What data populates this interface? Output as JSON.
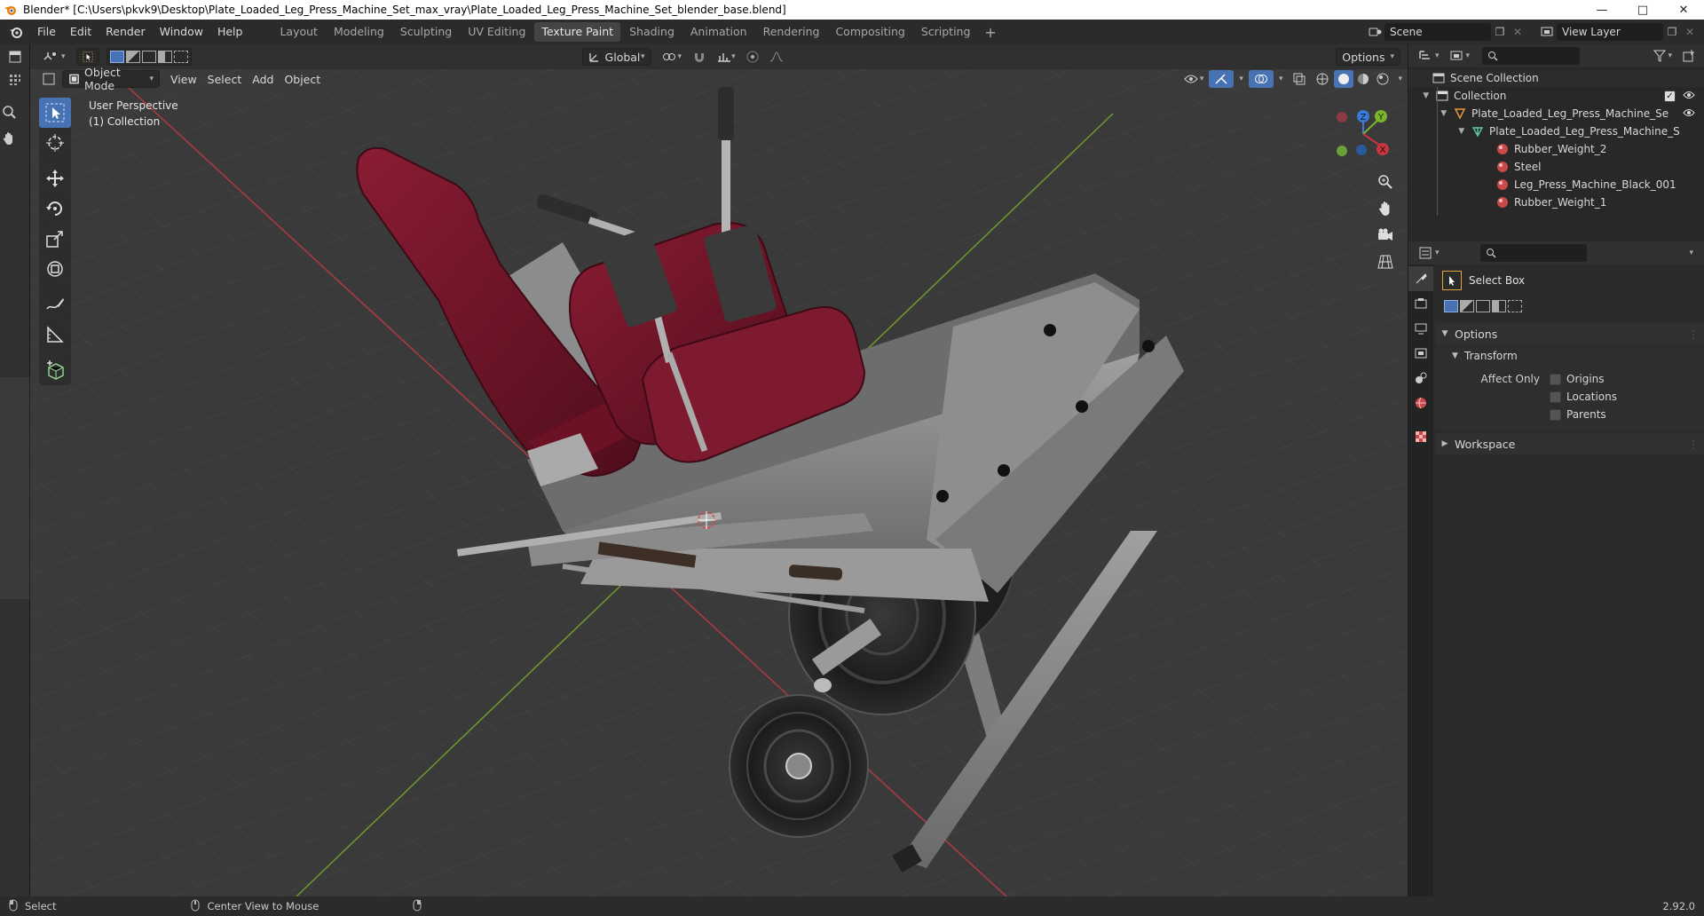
{
  "window": {
    "title": "Blender* [C:\\Users\\pkvk9\\Desktop\\Plate_Loaded_Leg_Press_Machine_Set_max_vray\\Plate_Loaded_Leg_Press_Machine_Set_blender_base.blend]",
    "controls": [
      "minimize-icon",
      "maximize-icon",
      "close-icon"
    ]
  },
  "menu": [
    "File",
    "Edit",
    "Render",
    "Window",
    "Help"
  ],
  "workspaces": [
    "Layout",
    "Modeling",
    "Sculpting",
    "UV Editing",
    "Texture Paint",
    "Shading",
    "Animation",
    "Rendering",
    "Compositing",
    "Scripting"
  ],
  "active_workspace": "Texture Paint",
  "scene": {
    "label": "Scene",
    "view_layer": "View Layer"
  },
  "viewport_header": {
    "orientation": "Global",
    "options": "Options"
  },
  "viewport_subheader": {
    "mode": "Object Mode",
    "menus": [
      "View",
      "Select",
      "Add",
      "Object"
    ]
  },
  "viewport_info": {
    "perspective": "User Perspective",
    "collection": "(1) Collection"
  },
  "gizmo_axes": {
    "z": "Z",
    "y": "Y",
    "x": "X"
  },
  "outliner": {
    "root": "Scene Collection",
    "collection": "Collection",
    "object": "Plate_Loaded_Leg_Press_Machine_Set_n",
    "mesh": "Plate_Loaded_Leg_Press_Machine_S",
    "materials": [
      "Rubber_Weight_2",
      "Steel",
      "Leg_Press_Machine_Black_001",
      "Rubber_Weight_1"
    ]
  },
  "properties": {
    "tool_name": "Select Box",
    "options_label": "Options",
    "transform_label": "Transform",
    "affect_only_label": "Affect Only",
    "affect_only": [
      "Origins",
      "Locations",
      "Parents"
    ],
    "workspace_label": "Workspace"
  },
  "statusbar": {
    "select": "Select",
    "center_view": "Center View to Mouse",
    "version": "2.92.0"
  },
  "colors": {
    "accent": "#4772b3",
    "viewport_bg": "#3a3a3a",
    "seat": "#6e1428",
    "frame": "#8a8a8a",
    "x_axis": "#c8363f",
    "y_axis": "#7ab52c",
    "z_axis": "#3b7ad8"
  }
}
